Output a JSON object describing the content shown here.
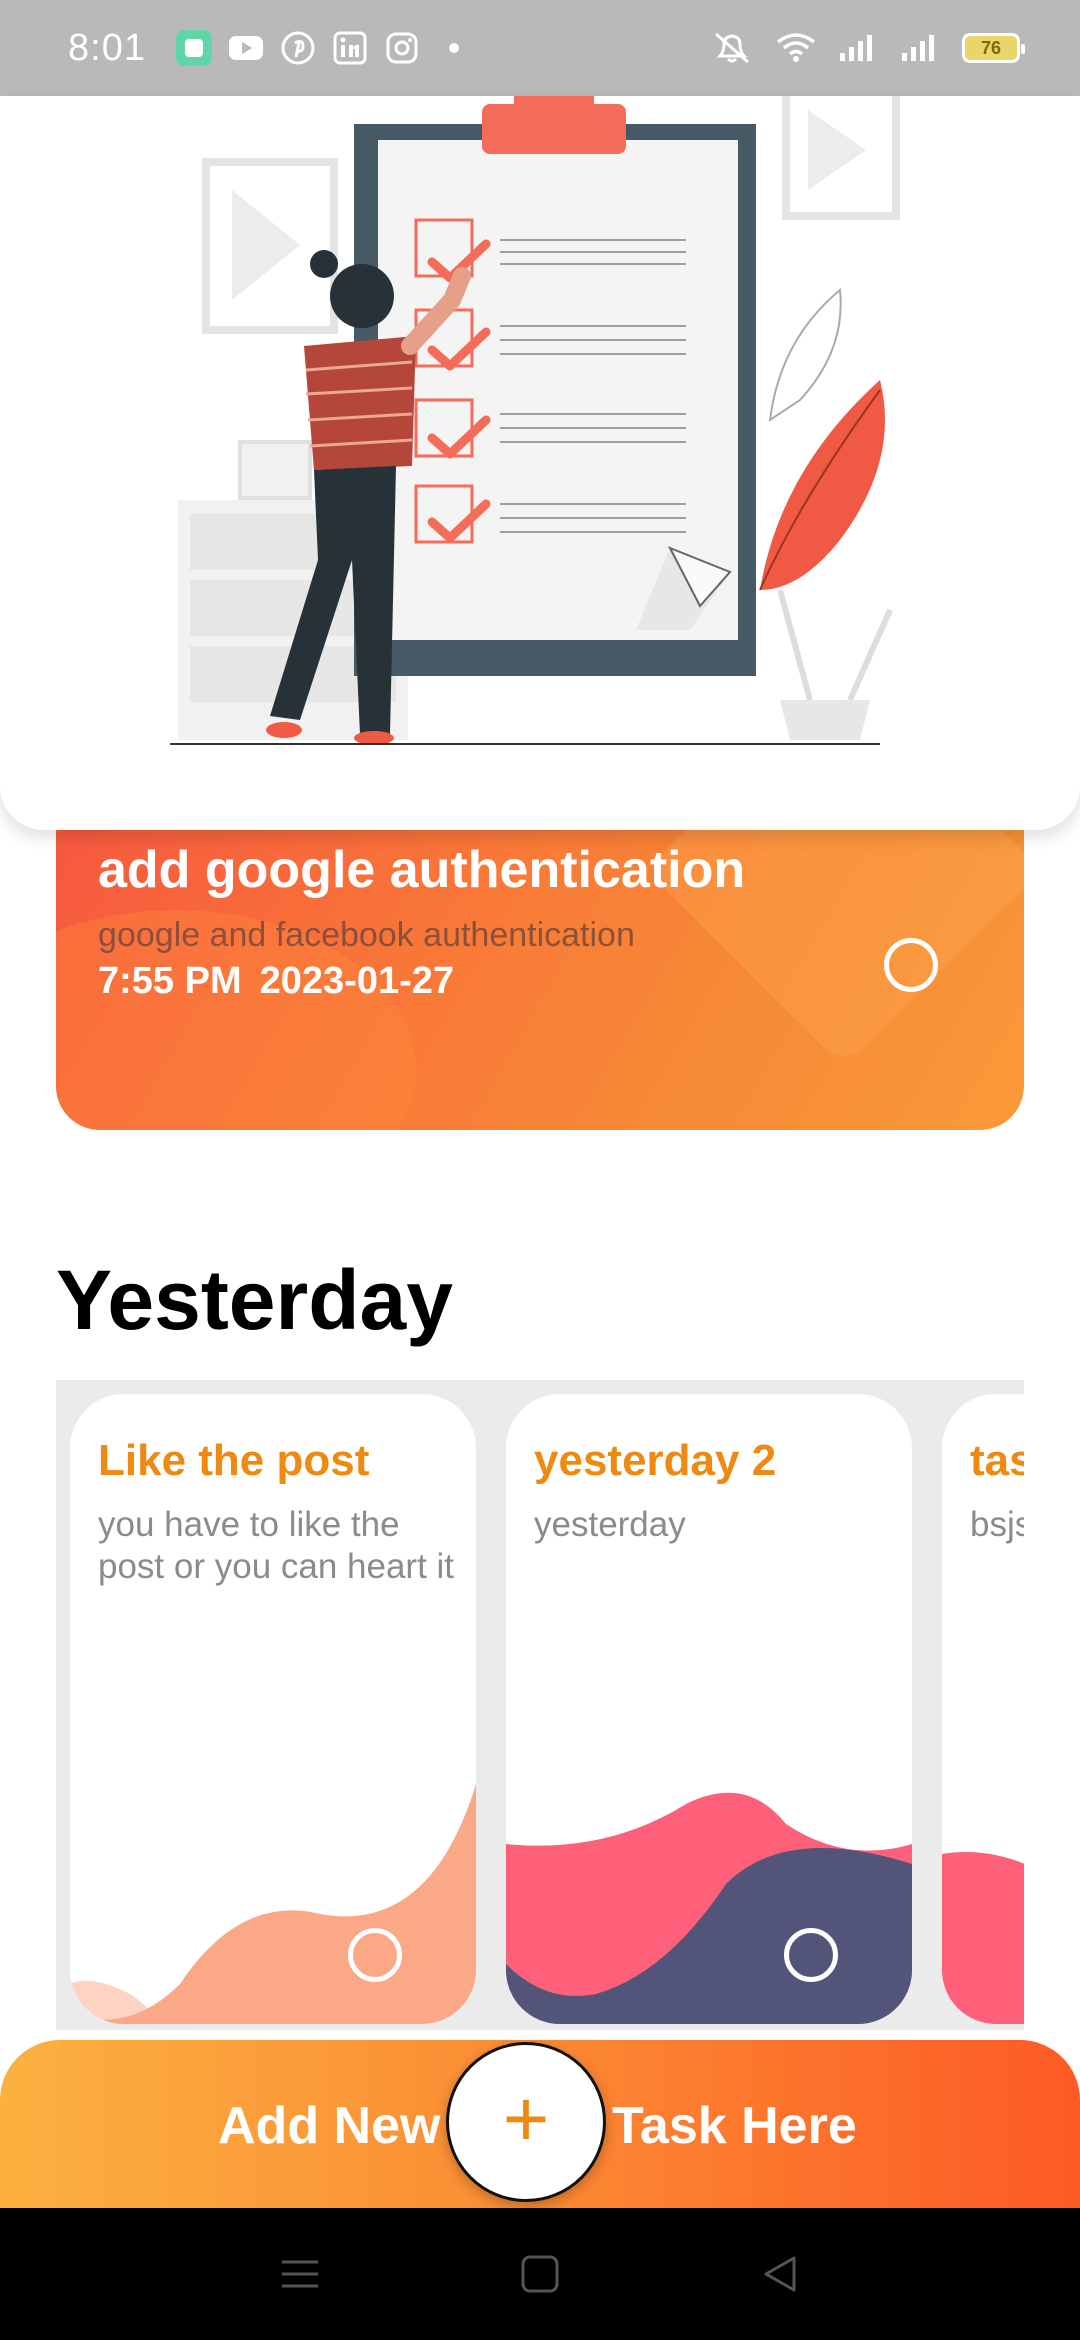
{
  "status_bar": {
    "time": "8:01",
    "battery": "76",
    "apps": [
      "app-icon",
      "youtube-icon",
      "pinterest-icon",
      "linkedin-icon",
      "instagram-icon",
      "dot-icon"
    ]
  },
  "featured_task": {
    "title": "add google authentication",
    "description": "google and facebook authentication",
    "time": "7:55 PM",
    "date": "2023-01-27"
  },
  "yesterday": {
    "heading": "Yesterday",
    "cards": [
      {
        "title": "Like the post",
        "description": "you have to like the post or you can heart it"
      },
      {
        "title": "yesterday 2",
        "description": "yesterday"
      },
      {
        "title": "tas",
        "description": "bsjs"
      }
    ]
  },
  "add_bar": {
    "left_label": "Add New",
    "right_label": "Task Here",
    "plus": "+"
  },
  "colors": {
    "accent": "#ee8a12",
    "orange_gradient_start": "#fbb140",
    "orange_gradient_end": "#fd5a24",
    "wave_pink": "#fe6079",
    "wave_navy": "#525579",
    "wave_peach": "#fba887"
  }
}
